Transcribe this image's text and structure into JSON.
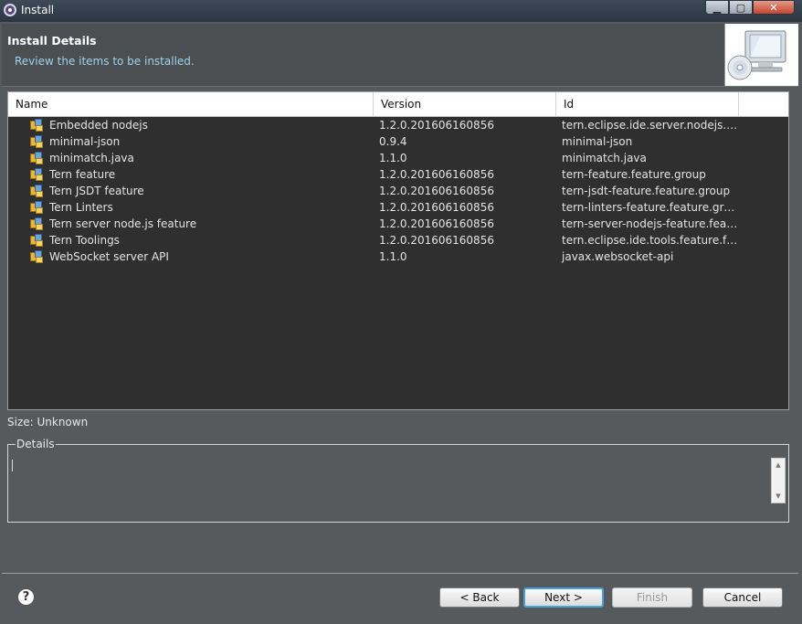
{
  "window": {
    "title": "Install"
  },
  "header": {
    "title": "Install Details",
    "subtitle": "Review the items to be installed."
  },
  "table": {
    "columns": [
      "Name",
      "Version",
      "Id"
    ],
    "rows": [
      {
        "name": "Embedded nodejs",
        "version": "1.2.0.201606160856",
        "id": "tern.eclipse.ide.server.nodejs.emb…"
      },
      {
        "name": "minimal-json",
        "version": "0.9.4",
        "id": "minimal-json"
      },
      {
        "name": "minimatch.java",
        "version": "1.1.0",
        "id": "minimatch.java"
      },
      {
        "name": "Tern feature",
        "version": "1.2.0.201606160856",
        "id": "tern-feature.feature.group"
      },
      {
        "name": "Tern JSDT feature",
        "version": "1.2.0.201606160856",
        "id": "tern-jsdt-feature.feature.group"
      },
      {
        "name": "Tern Linters",
        "version": "1.2.0.201606160856",
        "id": "tern-linters-feature.feature.group"
      },
      {
        "name": "Tern server node.js feature",
        "version": "1.2.0.201606160856",
        "id": "tern-server-nodejs-feature.feature.…"
      },
      {
        "name": "Tern Toolings",
        "version": "1.2.0.201606160856",
        "id": "tern.eclipse.ide.tools.feature.featur…"
      },
      {
        "name": "WebSocket server API",
        "version": "1.1.0",
        "id": "javax.websocket-api"
      }
    ]
  },
  "size_label": "Size: Unknown",
  "details": {
    "legend": "Details",
    "text": ""
  },
  "buttons": {
    "back": "< Back",
    "next": "Next >",
    "finish": "Finish",
    "cancel": "Cancel",
    "help": "?"
  }
}
